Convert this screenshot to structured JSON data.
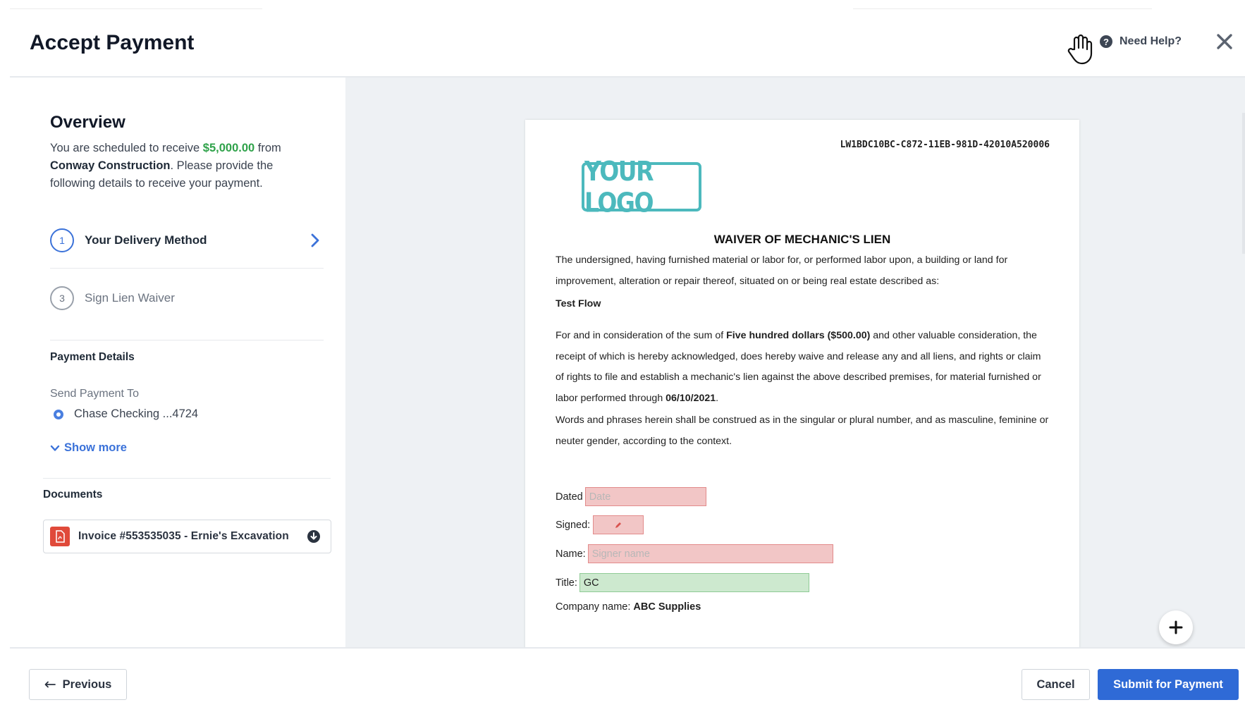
{
  "header": {
    "title": "Accept Payment",
    "help_label": "Need Help?"
  },
  "overview": {
    "title": "Overview",
    "desc_prefix": "You are scheduled to receive ",
    "amount": "$5,000.00",
    "desc_mid": " from ",
    "company": "Conway Construction",
    "desc_suffix": ". Please provide the following details to receive your payment."
  },
  "steps": [
    {
      "number": "1",
      "label": "Your Delivery Method"
    },
    {
      "number": "3",
      "label": "Sign Lien Waiver"
    }
  ],
  "payment_details": {
    "title": "Payment Details",
    "send_to_label": "Send Payment To",
    "account": "Chase Checking ...4724",
    "show_more": "Show more"
  },
  "documents": {
    "title": "Documents",
    "items": [
      {
        "name": "Invoice #553535035 - Ernie's Excavation"
      }
    ]
  },
  "waiver": {
    "doc_id": "LW1BDC10BC-C872-11EB-981D-42010A520006",
    "logo_text": "YOUR LOGO",
    "title": "WAIVER OF MECHANIC'S LIEN",
    "para1": "The undersigned, having furnished material or labor for, or performed labor upon, a building or land for improvement, alteration or repair thereof, situated on or being real estate described as:",
    "project": "Test Flow",
    "para3_a": "For and in consideration of the sum of ",
    "para3_amount": "Five hundred dollars ($500.00)",
    "para3_b": " and other valuable consideration, the receipt of which is hereby acknowledged, does hereby waive and release any and all liens, and rights or claim of rights to file and establish a mechanic's lien against the above described premises, for material furnished or labor performed through ",
    "para3_date": "06/10/2021",
    "para3_c": ".",
    "para4": "Words and phrases herein shall be construed as in the singular or plural number, and as masculine, feminine or neuter gender, according to the context.",
    "fields": {
      "dated_label": "Dated",
      "dated_placeholder": "Date",
      "signed_label": "Signed:",
      "name_label": "Name:",
      "name_placeholder": "Signer name",
      "title_label": "Title:",
      "title_value": "GC",
      "company_label": "Company name:",
      "company_value": "ABC Supplies"
    }
  },
  "footer": {
    "previous": "Previous",
    "cancel": "Cancel",
    "submit": "Submit for Payment"
  },
  "colors": {
    "accent": "#2f6ad6",
    "amount_green": "#2fa24a",
    "logo_teal": "#4cb9bd",
    "required_field": "#f2c6c6",
    "filled_field": "#cde9cf"
  },
  "icons": {
    "hand": "hand-cursor-icon",
    "help": "question-circle-icon",
    "close": "close-icon",
    "chevron_right": "chevron-right-icon",
    "chevron_down": "chevron-down-icon",
    "pdf": "pdf-file-icon",
    "download": "download-icon",
    "signature": "signature-pen-icon",
    "plus": "plus-icon",
    "arrow_left": "arrow-left-icon"
  }
}
